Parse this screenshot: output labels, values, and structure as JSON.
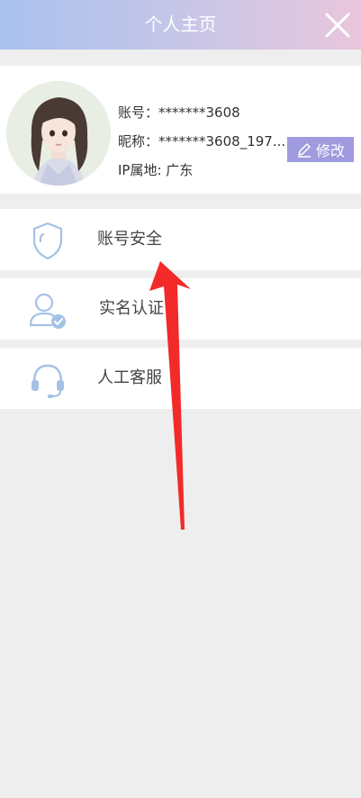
{
  "header": {
    "title": "个人主页"
  },
  "profile": {
    "account_label": "账号：",
    "account_value": "*******3608",
    "nickname_label": "昵称：",
    "nickname_value": "*******3608_197...",
    "ip_label": "IP属地: ",
    "ip_value": "广东",
    "edit_label": "修改"
  },
  "menu": [
    {
      "label": "账号安全",
      "icon": "shield-icon"
    },
    {
      "label": "实名认证",
      "icon": "user-verified-icon"
    },
    {
      "label": "人工客服",
      "icon": "headset-icon"
    }
  ],
  "colors": {
    "header_gradient_start": "#a9c1ee",
    "header_gradient_end": "#e9c6dc",
    "icon_blue": "#a4c2e6",
    "edit_button": "#9f9bde",
    "arrow_red": "#f22a2a"
  }
}
